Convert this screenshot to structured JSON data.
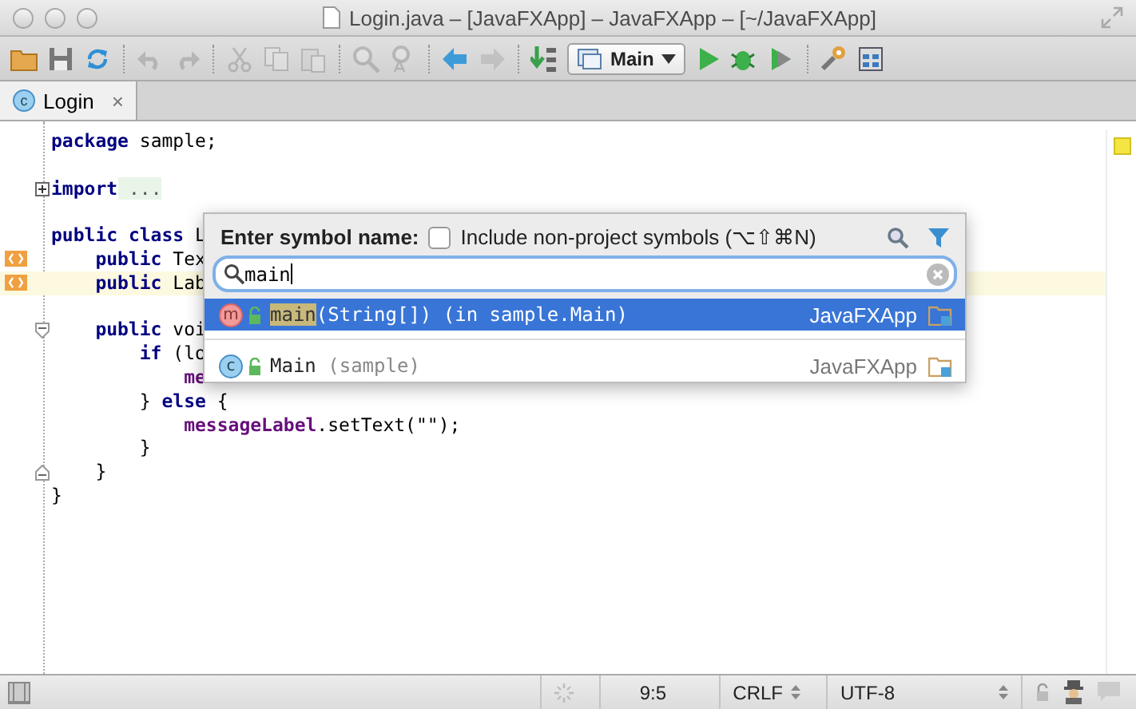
{
  "window": {
    "title": "Login.java – [JavaFXApp] – JavaFXApp – [~/JavaFXApp]"
  },
  "toolbar": [
    {
      "kind": "folder",
      "disabled": false
    },
    {
      "kind": "save",
      "disabled": false
    },
    {
      "kind": "sync",
      "disabled": false
    },
    {
      "kind": "sep"
    },
    {
      "kind": "undo",
      "disabled": true
    },
    {
      "kind": "redo",
      "disabled": true
    },
    {
      "kind": "sep"
    },
    {
      "kind": "cut",
      "disabled": true
    },
    {
      "kind": "copy",
      "disabled": true
    },
    {
      "kind": "paste",
      "disabled": true
    },
    {
      "kind": "sep"
    },
    {
      "kind": "find",
      "disabled": true
    },
    {
      "kind": "replace",
      "disabled": true
    },
    {
      "kind": "sep"
    },
    {
      "kind": "back",
      "disabled": false
    },
    {
      "kind": "forward",
      "disabled": true
    },
    {
      "kind": "sep"
    },
    {
      "kind": "make",
      "disabled": false
    },
    {
      "kind": "config",
      "label": "Main"
    },
    {
      "kind": "run",
      "disabled": false
    },
    {
      "kind": "debug",
      "disabled": false
    },
    {
      "kind": "coverage",
      "disabled": false
    },
    {
      "kind": "sep"
    },
    {
      "kind": "settings",
      "disabled": false
    },
    {
      "kind": "structure",
      "disabled": false
    }
  ],
  "tabs": [
    {
      "icon": "c",
      "label": "Login",
      "selected": true,
      "close": "×"
    }
  ],
  "editor": {
    "lines": [
      {
        "current": false,
        "marker": false,
        "fold_start": false,
        "folded": false,
        "fold_end": false,
        "tokens": [
          {
            "text": "package",
            "kind": "keyword"
          },
          {
            "text": " sample;",
            "kind": "plain"
          }
        ]
      },
      {
        "current": false,
        "marker": false,
        "fold_start": false,
        "folded": false,
        "fold_end": false
      },
      {
        "current": false,
        "marker": false,
        "fold_start": false,
        "folded": true,
        "fold_end": false,
        "tokens": [
          {
            "text": "import",
            "kind": "keyword"
          },
          {
            "text": " ...",
            "kind": "folded"
          }
        ]
      },
      {
        "current": false,
        "marker": false,
        "fold_start": false,
        "folded": false,
        "fold_end": false
      },
      {
        "current": false,
        "marker": false,
        "fold_start": false,
        "folded": false,
        "fold_end": false,
        "tokens": [
          {
            "text": "public class",
            "kind": "keyword"
          },
          {
            "text": " L",
            "kind": "plain"
          }
        ]
      },
      {
        "current": false,
        "marker": true,
        "fold_start": false,
        "folded": false,
        "fold_end": false,
        "tokens": [
          {
            "text": "    public",
            "kind": "keyword"
          },
          {
            "text": " Tex",
            "kind": "plain"
          }
        ]
      },
      {
        "current": true,
        "marker": true,
        "fold_start": false,
        "folded": false,
        "fold_end": false,
        "tokens": [
          {
            "text": "    public",
            "kind": "keyword"
          },
          {
            "text": " Lab",
            "kind": "plain"
          }
        ]
      },
      {
        "current": false,
        "marker": false,
        "fold_start": false,
        "folded": false,
        "fold_end": false
      },
      {
        "current": false,
        "marker": false,
        "fold_start": true,
        "folded": false,
        "fold_end": false,
        "tokens": [
          {
            "text": "    public",
            "kind": "keyword"
          },
          {
            "text": " voi",
            "kind": "plain"
          }
        ]
      },
      {
        "current": false,
        "marker": false,
        "fold_start": false,
        "folded": false,
        "fold_end": false,
        "tokens": [
          {
            "text": "        if",
            "kind": "keyword"
          },
          {
            "text": " (lo",
            "kind": "plain"
          }
        ]
      },
      {
        "current": false,
        "marker": false,
        "fold_start": false,
        "folded": false,
        "fold_end": false,
        "tokens": [
          {
            "text": "            me",
            "kind": "field"
          }
        ]
      },
      {
        "current": false,
        "marker": false,
        "fold_start": false,
        "folded": false,
        "fold_end": false,
        "tokens": [
          {
            "text": "        } ",
            "kind": "plain"
          },
          {
            "text": "else",
            "kind": "keyword"
          },
          {
            "text": " {",
            "kind": "plain"
          }
        ]
      },
      {
        "current": false,
        "marker": false,
        "fold_start": false,
        "folded": false,
        "fold_end": false,
        "tokens": [
          {
            "text": "            messageLabel",
            "kind": "field"
          },
          {
            "text": ".setText(\"\");",
            "kind": "plain"
          }
        ]
      },
      {
        "current": false,
        "marker": false,
        "fold_start": false,
        "folded": false,
        "fold_end": false,
        "tokens": [
          {
            "text": "        }",
            "kind": "plain"
          }
        ]
      },
      {
        "current": false,
        "marker": false,
        "fold_start": false,
        "folded": false,
        "fold_end": true,
        "tokens": [
          {
            "text": "    }",
            "kind": "plain"
          }
        ]
      },
      {
        "current": false,
        "marker": false,
        "fold_start": false,
        "folded": false,
        "fold_end": false,
        "tokens": [
          {
            "text": "}",
            "kind": "plain"
          }
        ]
      }
    ]
  },
  "popup": {
    "prompt": "Enter symbol name:",
    "include": {
      "label": "Include non-project symbols (⌥⇧⌘N)",
      "checked": false
    },
    "search": {
      "value": "main"
    },
    "results": [
      {
        "kind": "method",
        "icon": "m",
        "selected": true,
        "parts": [
          {
            "text": "main",
            "kind": "match"
          },
          {
            "text": "(String[]) (in sample.Main)",
            "kind": "plain"
          }
        ],
        "module": "JavaFXApp"
      },
      {
        "kind": "class",
        "icon": "c",
        "selected": false,
        "parts": [
          {
            "text": "Main",
            "kind": "plain"
          },
          {
            "text": " (sample)",
            "kind": "dim"
          }
        ],
        "module": "JavaFXApp"
      }
    ]
  },
  "status_bar": {
    "position": "9:5",
    "line_separator": "CRLF",
    "encoding": "UTF-8"
  }
}
